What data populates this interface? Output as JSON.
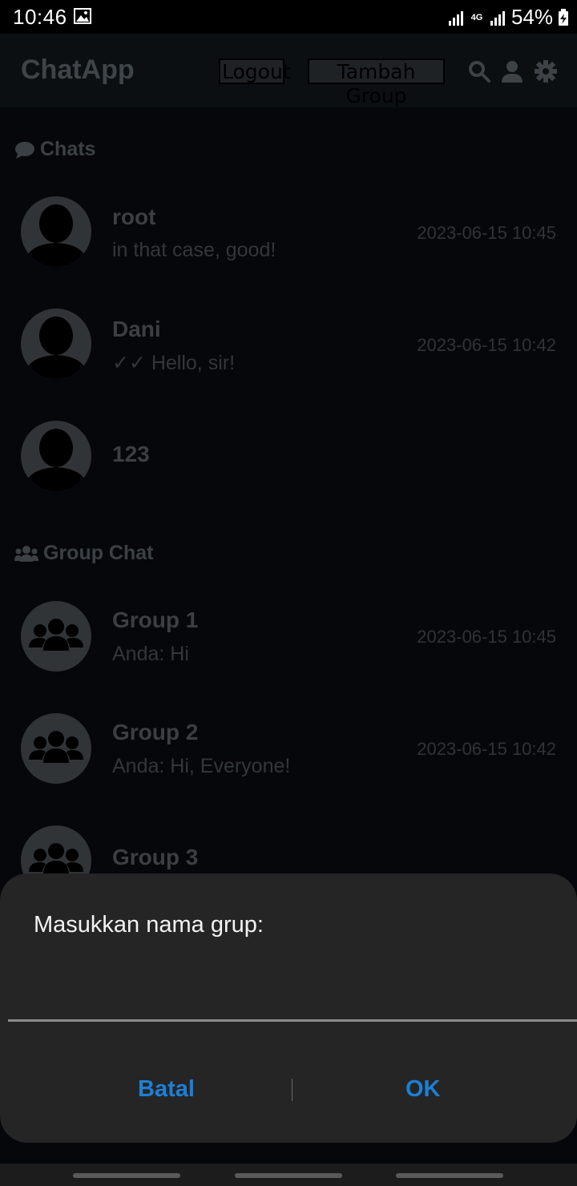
{
  "status_bar": {
    "time": "10:46",
    "network": "4G",
    "battery": "54%"
  },
  "app_bar": {
    "title": "ChatApp",
    "logout_label": "Logout",
    "add_group_label": "Tambah Group",
    "icons": [
      "search-icon",
      "user-icon",
      "gear-icon"
    ]
  },
  "chats": {
    "section_label": "Chats",
    "items": [
      {
        "name": "root",
        "preview": "in that case, good!",
        "time": "2023-06-15 10:45"
      },
      {
        "name": "Dani",
        "preview": "✓✓ Hello, sir!",
        "time": "2023-06-15 10:42"
      },
      {
        "name": "123",
        "preview": "",
        "time": ""
      }
    ]
  },
  "groups": {
    "section_label": "Group Chat",
    "items": [
      {
        "name": "Group 1",
        "preview": "Anda: Hi",
        "time": "2023-06-15 10:45"
      },
      {
        "name": "Group 2",
        "preview": "Anda: Hi, Everyone!",
        "time": "2023-06-15 10:42"
      },
      {
        "name": "Group 3",
        "preview": "",
        "time": ""
      }
    ]
  },
  "dialog": {
    "title": "Masukkan nama grup:",
    "input_value": "",
    "cancel_label": "Batal",
    "ok_label": "OK"
  },
  "colors": {
    "accent": "#1d7fd6",
    "dialog_bg": "#252525",
    "app_bg": "#06070a"
  }
}
